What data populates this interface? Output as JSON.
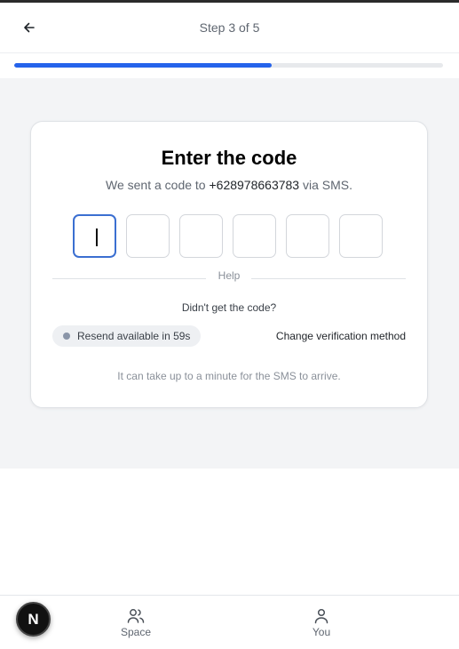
{
  "header": {
    "step_label": "Step 3 of 5",
    "progress": 0.6,
    "back_icon": "arrow-left-icon"
  },
  "card": {
    "title": "Enter the code",
    "subtitle_prefix": "We sent a code to ",
    "phone": "+628978663783",
    "subtitle_suffix": " via SMS.",
    "code_length": 6,
    "code_digits": [
      "",
      "",
      "",
      "",
      "",
      ""
    ],
    "help_label": "Help",
    "didnt_get": "Didn't get the code?",
    "resend_text": "Resend available in 59s",
    "change_method": "Change verification method",
    "footnote": "It can take up to a minute for the SMS to arrive."
  },
  "bottom_nav": {
    "avatar_letter": "N",
    "items": [
      {
        "label": "Space",
        "icon": "users-icon"
      },
      {
        "label": "You",
        "icon": "user-icon"
      }
    ]
  },
  "colors": {
    "accent": "#2563eb",
    "otp_active_border": "#3b6fd1",
    "background": "#f3f4f6"
  }
}
